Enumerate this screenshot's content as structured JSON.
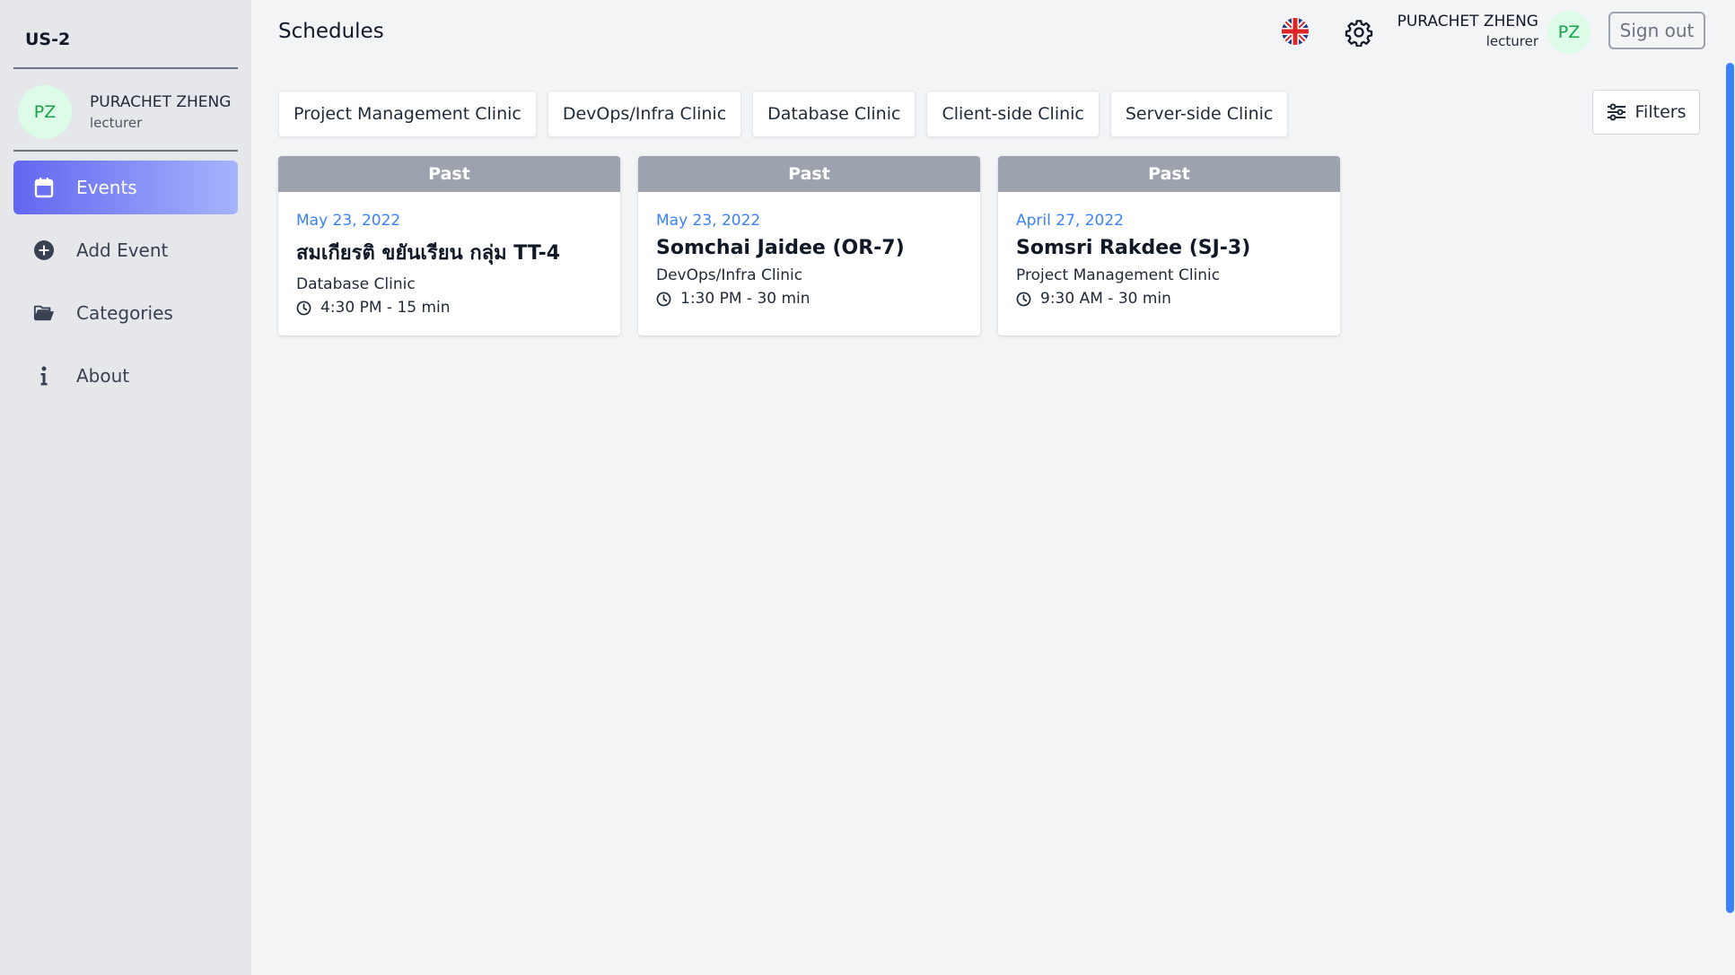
{
  "app": {
    "brand": "US-2"
  },
  "user": {
    "name": "PURACHET ZHENG",
    "role": "lecturer",
    "initials": "PZ"
  },
  "sidebar": {
    "items": [
      {
        "label": "Events",
        "icon": "calendar-icon",
        "active": true
      },
      {
        "label": "Add Event",
        "icon": "plus-circle-icon",
        "active": false
      },
      {
        "label": "Categories",
        "icon": "folder-open-icon",
        "active": false
      },
      {
        "label": "About",
        "icon": "info-icon",
        "active": false
      }
    ]
  },
  "header": {
    "title": "Schedules",
    "language_icon": "uk-flag-icon",
    "settings_icon": "gear-icon",
    "signout_label": "Sign out"
  },
  "categories": [
    "Project Management Clinic",
    "DevOps/Infra Clinic",
    "Database Clinic",
    "Client-side Clinic",
    "Server-side Clinic"
  ],
  "filters_label": "Filters",
  "events": [
    {
      "status": "Past",
      "date": "May 23, 2022",
      "title": "สมเกียรติ ขยันเรียน กลุ่ม TT-4",
      "category": "Database Clinic",
      "time": "4:30 PM - 15 min"
    },
    {
      "status": "Past",
      "date": "May 23, 2022",
      "title": "Somchai Jaidee (OR-7)",
      "category": "DevOps/Infra Clinic",
      "time": "1:30 PM - 30 min"
    },
    {
      "status": "Past",
      "date": "April 27, 2022",
      "title": "Somsri Rakdee (SJ-3)",
      "category": "Project Management Clinic",
      "time": "9:30 AM - 30 min"
    }
  ],
  "colors": {
    "accent": "#6366f1",
    "date": "#3b82f6",
    "past_header": "#9ca3af",
    "avatar_bg": "#dcfce7",
    "avatar_text": "#16a34a"
  }
}
